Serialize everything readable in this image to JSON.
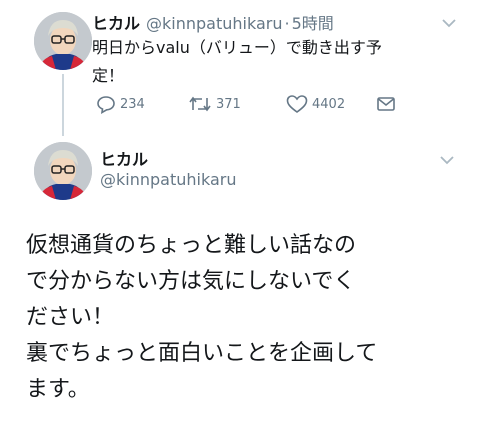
{
  "tweet1": {
    "display_name": "ヒカル",
    "handle": "@kinnpatuhikaru",
    "separator": "·",
    "time": "5時間",
    "text_lines": [
      "明日からvalu（バリュー）で動き出す予",
      "定！"
    ],
    "actions": {
      "reply_count": "234",
      "retweet_count": "371",
      "like_count": "4402"
    }
  },
  "tweet2": {
    "display_name": "ヒカル",
    "handle": "@kinnpatuhikaru",
    "text_lines": [
      "仮想通貨のちょっと難しい話なの",
      "で分からない方は気にしないでく",
      "ださい！",
      "裏でちょっと面白いことを企画して",
      "ます。"
    ]
  },
  "icons": {
    "reply": "reply-icon",
    "retweet": "retweet-icon",
    "like": "heart-icon",
    "dm": "envelope-icon",
    "more": "chevron-down-icon"
  },
  "colors": {
    "text": "#14171a",
    "secondary": "#657786",
    "thread_line": "#ccd6dd"
  }
}
